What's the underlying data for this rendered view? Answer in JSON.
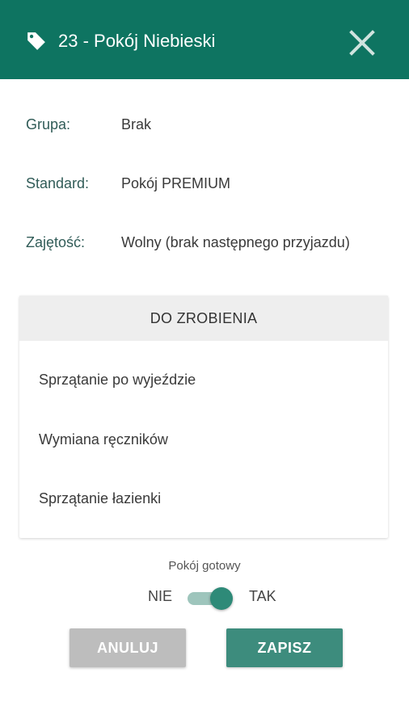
{
  "header": {
    "title": "23 - Pokój Niebieski",
    "icon": "tag-icon",
    "close_icon": "close-icon",
    "background": "#0e7461"
  },
  "details": [
    {
      "label": "Grupa:",
      "value": "Brak"
    },
    {
      "label": "Standard:",
      "value": "Pokój PREMIUM"
    },
    {
      "label": "Zajętość:",
      "value": "Wolny (brak następnego przyjazdu)"
    }
  ],
  "todo": {
    "title": "DO ZROBIENIA",
    "items": [
      "Sprzątanie po wyjeździe",
      "Wymiana ręczników",
      "Sprzątanie łazienki"
    ]
  },
  "ready": {
    "label": "Pokój gotowy",
    "off_label": "NIE",
    "on_label": "TAK",
    "value": true
  },
  "buttons": {
    "cancel": "ANULUJ",
    "save": "ZAPISZ"
  }
}
